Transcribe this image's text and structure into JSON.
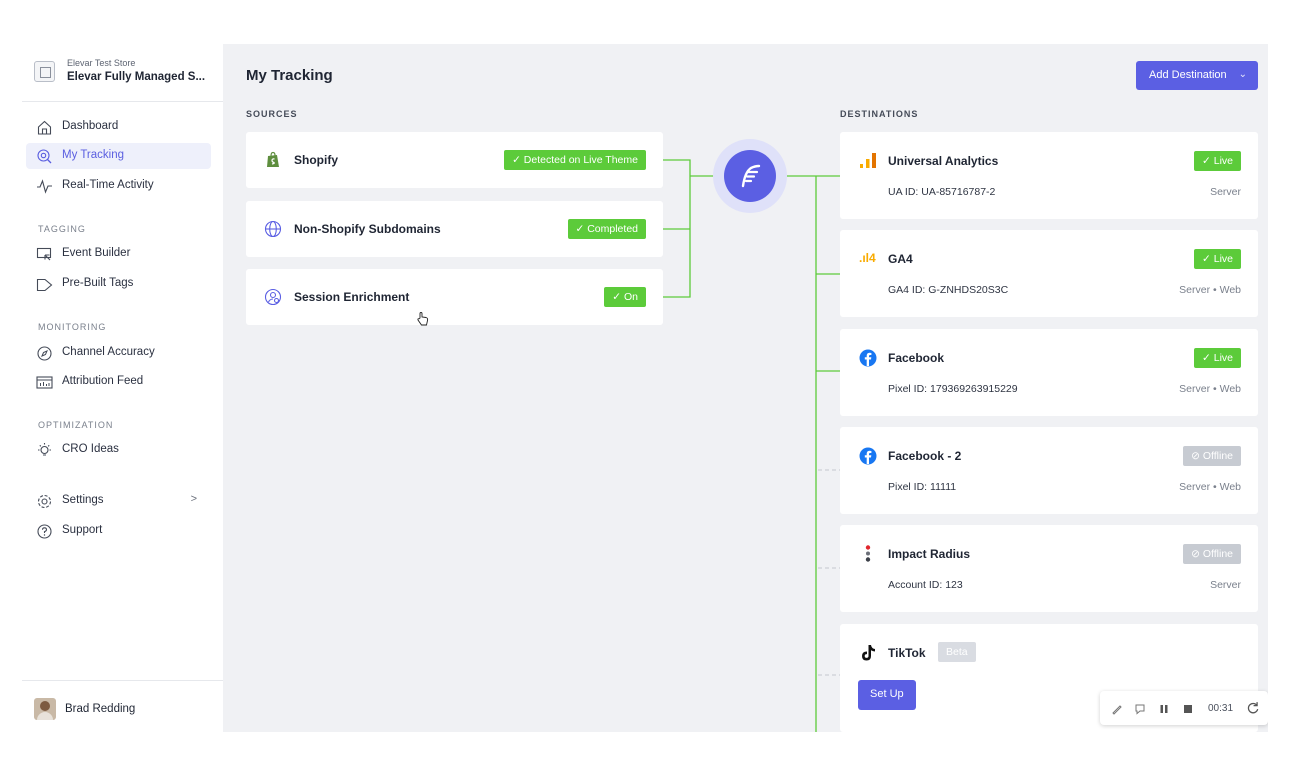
{
  "store": {
    "subtitle": "Elevar Test Store",
    "name": "Elevar Fully Managed S..."
  },
  "nav": {
    "dashboard": "Dashboard",
    "my_tracking": "My Tracking",
    "realtime": "Real-Time Activity",
    "section_tagging": "TAGGING",
    "event_builder": "Event Builder",
    "prebuilt_tags": "Pre-Built Tags",
    "section_monitoring": "MONITORING",
    "channel_accuracy": "Channel Accuracy",
    "attribution_feed": "Attribution Feed",
    "section_optimization": "OPTIMIZATION",
    "cro_ideas": "CRO Ideas",
    "settings": "Settings",
    "settings_chevron": ">",
    "support": "Support"
  },
  "user": {
    "name": "Brad Redding"
  },
  "main": {
    "title": "My Tracking",
    "add_button": "Add Destination",
    "add_caret": "⌄",
    "sources_label": "SOURCES",
    "destinations_label": "DESTINATIONS"
  },
  "sources": [
    {
      "name": "Shopify",
      "badge": "✓  Detected on Live Theme"
    },
    {
      "name": "Non-Shopify Subdomains",
      "badge": "✓  Completed"
    },
    {
      "name": "Session Enrichment",
      "badge": "✓  On"
    }
  ],
  "destinations": [
    {
      "name": "Universal Analytics",
      "badge": "✓  Live",
      "id_text": "UA ID: UA-85716787-2",
      "mode": "Server"
    },
    {
      "name": "GA4",
      "badge": "✓  Live",
      "id_text": "GA4 ID: G-ZNHDS20S3C",
      "mode": "Server • Web",
      "icon_text": ".ıl4"
    },
    {
      "name": "Facebook",
      "badge": "✓  Live",
      "id_text": "Pixel ID: 179369263915229",
      "mode": "Server • Web"
    },
    {
      "name": "Facebook - 2",
      "badge": "⊘  Offline",
      "id_text": "Pixel ID: 11111",
      "mode": "Server • Web"
    },
    {
      "name": "Impact Radius",
      "badge": "⊘  Offline",
      "id_text": "Account ID: 123",
      "mode": "Server"
    },
    {
      "name": "TikTok",
      "badge": "Beta",
      "button": "Set Up"
    }
  ],
  "recorder": {
    "time": "00:31"
  },
  "colors": {
    "accent": "#5b5fe3",
    "live": "#5ccb3a",
    "offline": "#c7cbd2",
    "background": "#f0f1f4"
  }
}
